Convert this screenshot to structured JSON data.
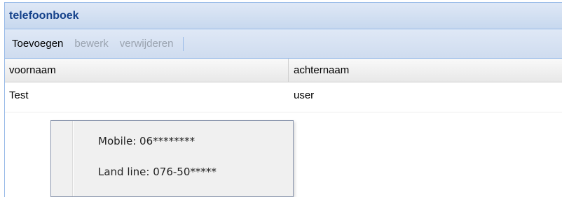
{
  "panel": {
    "title": "telefoonboek"
  },
  "toolbar": {
    "add_label": "Toevoegen",
    "edit_label": "bewerk",
    "delete_label": "verwijderen"
  },
  "grid": {
    "columns": [
      "voornaam",
      "achternaam"
    ],
    "rows": [
      {
        "voornaam": "Test",
        "achternaam": "user"
      }
    ]
  },
  "context_menu": {
    "items": [
      "Mobile: 06********",
      "Land line: 076-50*****"
    ]
  }
}
